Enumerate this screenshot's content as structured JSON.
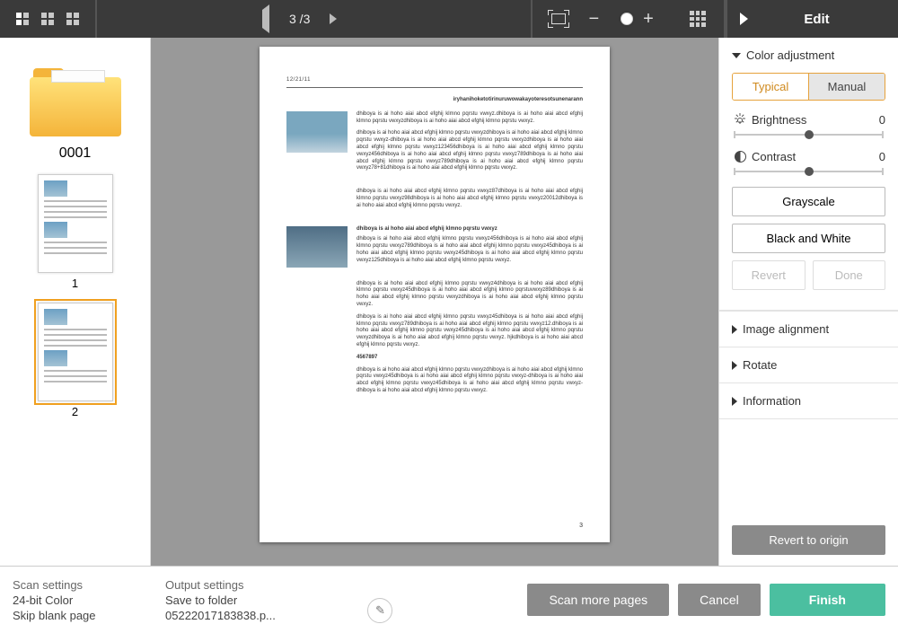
{
  "topbar": {
    "page_indicator": "3 /3",
    "edit_label": "Edit"
  },
  "left": {
    "folder_name": "0001",
    "thumbs": [
      "1",
      "2"
    ]
  },
  "preview": {
    "header_code": "12/21/11",
    "headline": "iryhanihoketotirinuruwowakayoteresotsunenarann",
    "section_title": "dhiboya is ai hoho aiai abcd efghij klmno pqrstu vwxyz",
    "code_a": "4567897",
    "pgnum": "3"
  },
  "edit": {
    "color_adjustment": "Color adjustment",
    "typical": "Typical",
    "manual": "Manual",
    "brightness_label": "Brightness",
    "brightness_value": "0",
    "contrast_label": "Contrast",
    "contrast_value": "0",
    "grayscale": "Grayscale",
    "bw": "Black and White",
    "revert": "Revert",
    "done": "Done",
    "image_alignment": "Image alignment",
    "rotate": "Rotate",
    "information": "Information",
    "revert_origin": "Revert to origin"
  },
  "bottom": {
    "scan_hdr": "Scan settings",
    "scan_line1": "24-bit Color",
    "scan_line2": "Skip blank page",
    "out_hdr": "Output settings",
    "out_line1": "Save to folder",
    "out_line2": "05222017183838.p...",
    "scan_more": "Scan more pages",
    "cancel": "Cancel",
    "finish": "Finish"
  }
}
